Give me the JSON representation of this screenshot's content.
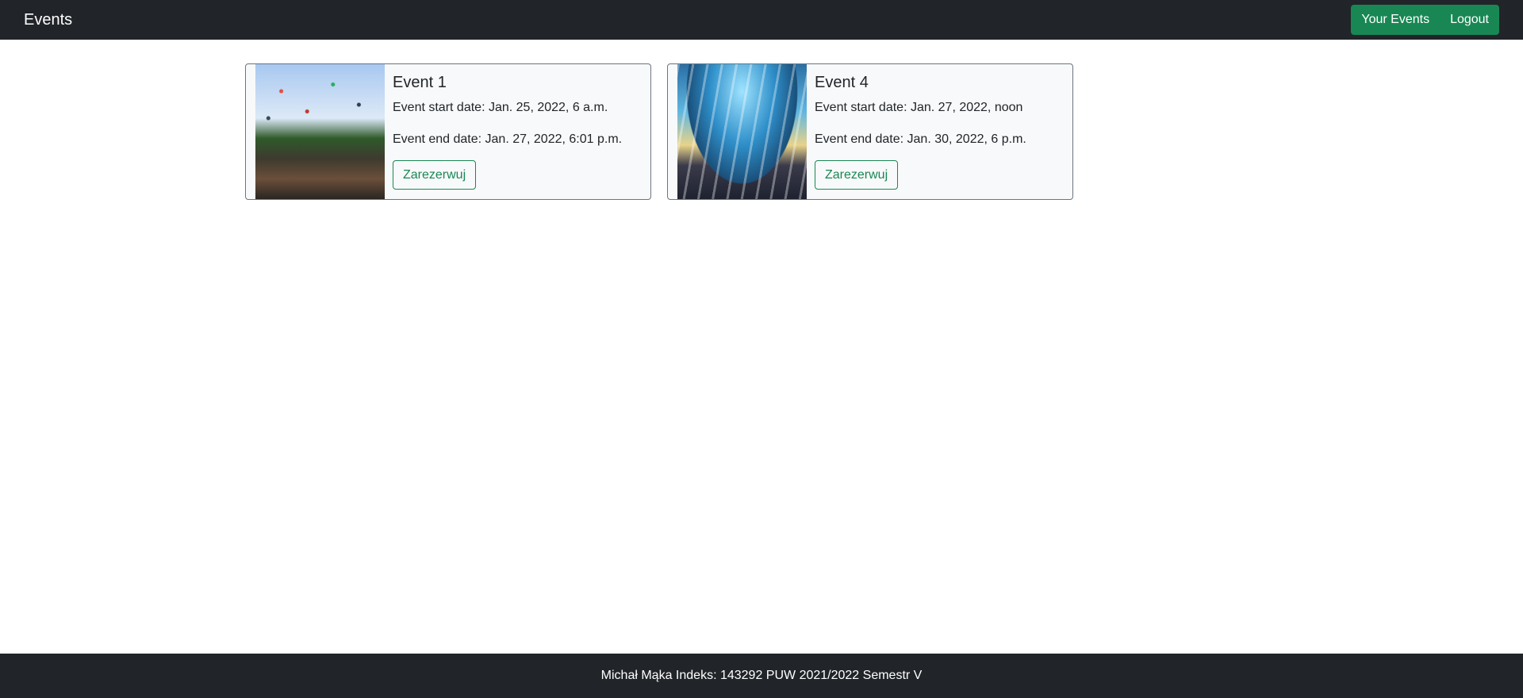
{
  "navbar": {
    "brand": "Events",
    "your_events_label": "Your Events",
    "logout_label": "Logout"
  },
  "events": [
    {
      "title": "Event 1",
      "start": "Event start date: Jan. 25, 2022, 6 a.m.",
      "end": "Event end date: Jan. 27, 2022, 6:01 p.m.",
      "button": "Zarezerwuj"
    },
    {
      "title": "Event 4",
      "start": "Event start date: Jan. 27, 2022, noon",
      "end": "Event end date: Jan. 30, 2022, 6 p.m.",
      "button": "Zarezerwuj"
    }
  ],
  "footer": {
    "text": "Michał Mąka Indeks: 143292 PUW 2021/2022 Semestr V"
  },
  "colors": {
    "navbar": "#212529",
    "accent": "#198754",
    "card_background": "#f8f9fa"
  }
}
